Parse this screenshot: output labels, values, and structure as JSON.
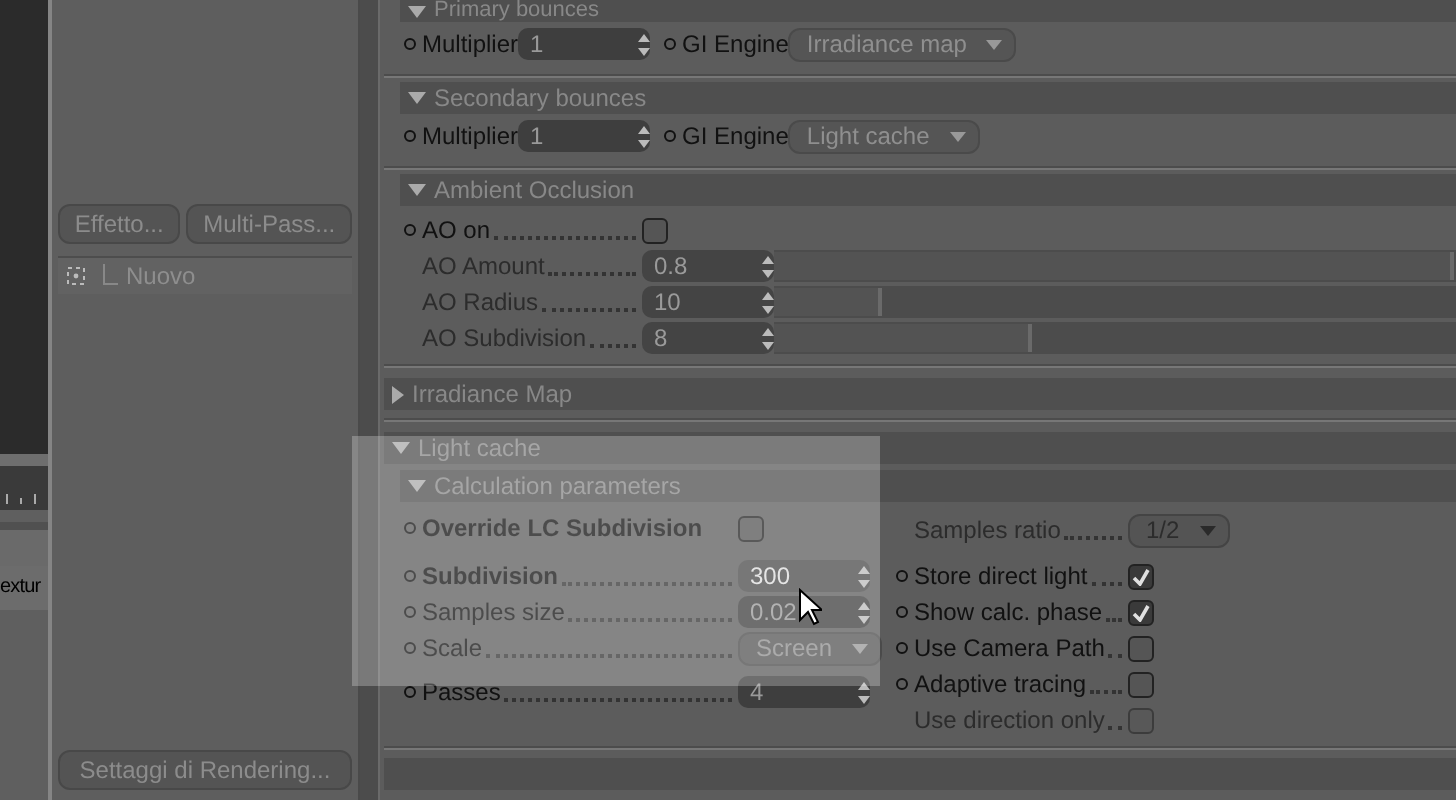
{
  "viewport_strip": {
    "partial_label": "extur"
  },
  "render_panel": {
    "buttons": [
      {
        "label": "Effetto..."
      },
      {
        "label": "Multi-Pass..."
      }
    ],
    "tree_items": [
      {
        "label": "Nuovo"
      }
    ],
    "footer_button": {
      "label": "Settaggi di Rendering..."
    }
  },
  "sections": [
    {
      "kind": "group",
      "subsections": [
        {
          "title": "Primary bounces",
          "expanded": true,
          "kind": "inline",
          "fields": [
            {
              "kind": "spinner",
              "label": "Multiplier",
              "value": "1",
              "disabled": false,
              "dotted_leader": false
            },
            {
              "kind": "dropdown",
              "label": "GI Engine",
              "value": "Irradiance map",
              "disabled": false,
              "dotted_leader": false
            }
          ]
        },
        {
          "title": "Secondary bounces",
          "expanded": true,
          "kind": "inline",
          "fields": [
            {
              "kind": "spinner",
              "label": "Multiplier",
              "value": "1",
              "disabled": false,
              "dotted_leader": false
            },
            {
              "kind": "dropdown",
              "label": "GI Engine",
              "value": "Light cache",
              "disabled": false,
              "dotted_leader": false
            }
          ]
        },
        {
          "title": "Ambient Occlusion",
          "expanded": true,
          "kind": "stacked",
          "fields": [
            {
              "kind": "checkbox",
              "label": "AO on",
              "checked": false,
              "disabled": false,
              "dotted_leader": true
            },
            {
              "kind": "slider",
              "label": "AO Amount",
              "value": "0.8",
              "level": 1,
              "disabled": true,
              "dotted_leader": true
            },
            {
              "kind": "slider",
              "label": "AO Radius",
              "value": "10",
              "level": 0.16,
              "disabled": true,
              "dotted_leader": true
            },
            {
              "kind": "slider",
              "label": "AO Subdivision",
              "value": "8",
              "level": 0.38,
              "disabled": true,
              "dotted_leader": true
            }
          ]
        }
      ]
    },
    {
      "kind": "section",
      "title": "Irradiance Map",
      "expanded": false
    },
    {
      "kind": "section",
      "title": "Light cache",
      "expanded": true,
      "highlighted": true,
      "subsections": [
        {
          "title": "Calculation parameters",
          "expanded": true,
          "kind": "columns",
          "left_fields": [
            {
              "kind": "checkbox",
              "label": "Override LC Subdivision",
              "checked": false,
              "disabled": false,
              "bold": true,
              "dotted_leader": false
            },
            {
              "kind": "spinner",
              "label": "Subdivision",
              "value": "300",
              "focused": true,
              "disabled": false,
              "bold": true,
              "dotted_leader": true
            },
            {
              "kind": "spinner",
              "label": "Samples size",
              "value": "0.02",
              "disabled": false,
              "dotted_leader": true
            },
            {
              "kind": "dropdown",
              "label": "Scale",
              "value": "Screen",
              "disabled": false,
              "dotted_leader": true
            },
            {
              "kind": "spinner",
              "label": "Passes",
              "value": "4",
              "disabled": false,
              "dotted_leader": true
            }
          ],
          "right_fields": [
            {
              "kind": "dropdown",
              "label": "Samples ratio",
              "value": "1/2",
              "disabled": true,
              "dotted_leader": true
            },
            {
              "kind": "checkbox",
              "label": "Store direct light",
              "checked": true,
              "disabled": false,
              "dotted_leader": true
            },
            {
              "kind": "checkbox",
              "label": "Show calc. phase",
              "checked": true,
              "disabled": false,
              "dotted_leader": true
            },
            {
              "kind": "checkbox",
              "label": "Use Camera Path",
              "checked": false,
              "disabled": false,
              "dotted_leader": true
            },
            {
              "kind": "checkbox",
              "label": "Adaptive tracing",
              "checked": false,
              "disabled": false,
              "dotted_leader": true
            },
            {
              "kind": "checkbox",
              "label": "Use direction only",
              "checked": false,
              "disabled": true,
              "dotted_leader": true
            }
          ]
        }
      ]
    }
  ]
}
